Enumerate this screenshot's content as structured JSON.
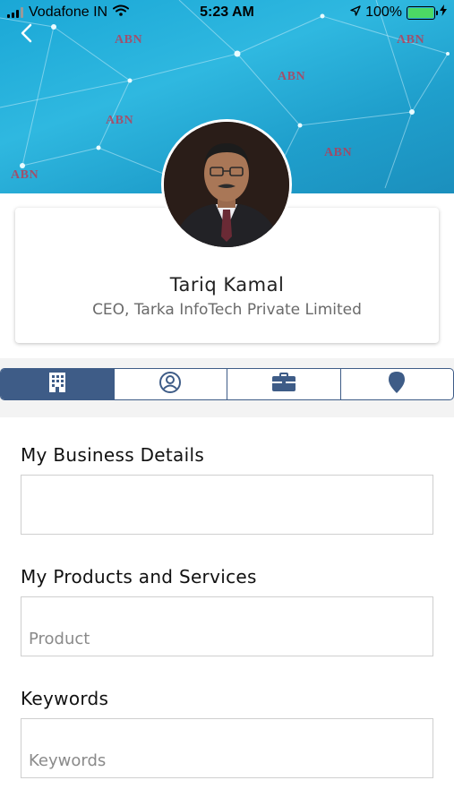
{
  "status_bar": {
    "carrier": "Vodafone IN",
    "time": "5:23 AM",
    "battery": "100%",
    "battery_level": 1.0
  },
  "cover": {
    "watermark_text": "ABN",
    "icon": "back-chevron-icon"
  },
  "profile": {
    "name": "Tariq Kamal",
    "title": "CEO, Tarka InfoTech Private Limited"
  },
  "tabs": [
    {
      "icon": "building-icon",
      "active": true
    },
    {
      "icon": "user-circle-icon",
      "active": false
    },
    {
      "icon": "briefcase-icon",
      "active": false
    },
    {
      "icon": "location-pin-icon",
      "active": false
    }
  ],
  "form": {
    "business_details": {
      "label": "My Business Details",
      "value": "",
      "placeholder": ""
    },
    "products": {
      "label": "My Products and Services",
      "value": "",
      "placeholder": "Product"
    },
    "keywords": {
      "label": "Keywords",
      "value": "",
      "placeholder": "Keywords"
    }
  },
  "colors": {
    "accent": "#3e5c87",
    "cover": "#1fa3d3",
    "battery": "#4cd964"
  }
}
